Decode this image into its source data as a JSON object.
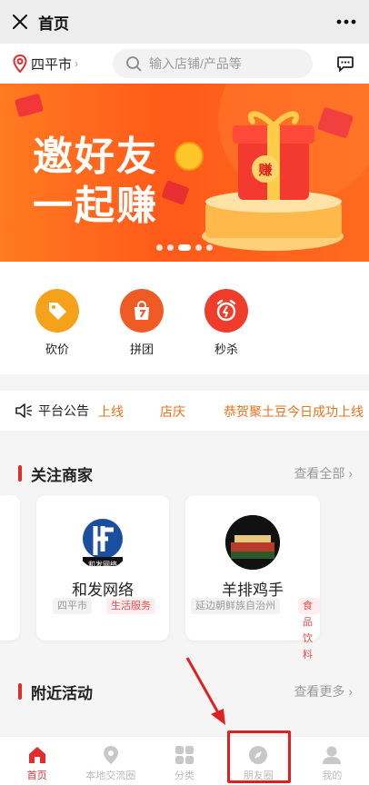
{
  "titlebar": {
    "title": "首页",
    "close_icon": "close-icon",
    "more_icon": "more-dots-icon"
  },
  "location": {
    "city": "四平市",
    "chevron": "›"
  },
  "search": {
    "placeholder": "输入店铺/产品等"
  },
  "banner": {
    "line1": "邀好友",
    "line2": "一起赚",
    "gift_tag": "赚",
    "slide_index": 3,
    "slide_count": 5
  },
  "categories": [
    {
      "label": "砍价",
      "color": "#f5a21a"
    },
    {
      "label": "拼团",
      "color": "#f05a24"
    },
    {
      "label": "秒杀",
      "color": "#f03c2a"
    }
  ],
  "notice": {
    "title": "平台公告",
    "items": [
      "上线",
      "店庆",
      "恭贺聚土豆今日成功上线"
    ]
  },
  "follow": {
    "title": "关注商家",
    "more": "查看全部",
    "merchants": [
      {
        "name": "和发网络",
        "logo_text": "和发网络",
        "region": "四平市",
        "category": "生活服务"
      },
      {
        "name": "羊排鸡手",
        "region": "延边朝鲜族自治州",
        "category": "食品饮料"
      }
    ]
  },
  "nearby": {
    "title": "附近活动",
    "more": "查看更多"
  },
  "tabbar": [
    {
      "label": "首页",
      "icon": "home-icon",
      "active": true
    },
    {
      "label": "本地交流圈",
      "icon": "location-icon",
      "active": false
    },
    {
      "label": "分类",
      "icon": "grid-icon",
      "active": false
    },
    {
      "label": "朋友圈",
      "icon": "compass-icon",
      "active": false
    },
    {
      "label": "我的",
      "icon": "user-icon",
      "active": false
    }
  ],
  "colors": {
    "accent": "#e32d2d",
    "notice": "#e8721c",
    "banner": "#ff6a1e"
  }
}
